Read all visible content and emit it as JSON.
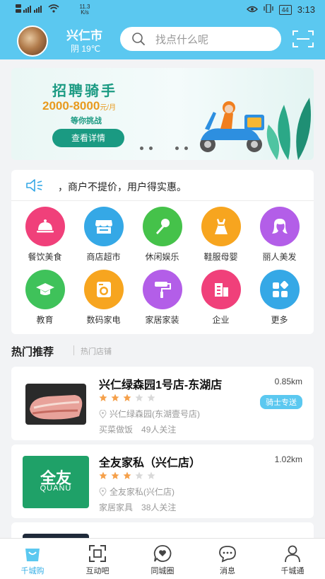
{
  "status_bar": {
    "net_speed": "11.3",
    "net_unit": "K/s",
    "battery": "44",
    "time": "3:13"
  },
  "header": {
    "city": "兴仁市",
    "weather": "阴 19℃",
    "search_placeholder": "找点什么呢"
  },
  "banner": {
    "title": "招聘骑手",
    "salary": "2000-8000",
    "salary_unit": "元/月",
    "subtitle": "等你挑战",
    "button": "查看详情"
  },
  "notice": {
    "text": "，商户不提价，用户得实惠。"
  },
  "categories": [
    {
      "label": "餐饮美食",
      "icon": "food-cloche-icon",
      "color": "#f0407a"
    },
    {
      "label": "商店超市",
      "icon": "store-icon",
      "color": "#35a8e6"
    },
    {
      "label": "休闲娱乐",
      "icon": "microphone-icon",
      "color": "#45c24a"
    },
    {
      "label": "鞋服母婴",
      "icon": "dress-icon",
      "color": "#f7a51f"
    },
    {
      "label": "丽人美发",
      "icon": "beauty-hair-icon",
      "color": "#b35ee8"
    },
    {
      "label": "教育",
      "icon": "graduation-cap-icon",
      "color": "#3fc25a"
    },
    {
      "label": "数码家电",
      "icon": "washing-machine-icon",
      "color": "#f7a51f"
    },
    {
      "label": "家居家装",
      "icon": "paint-roller-icon",
      "color": "#b35ee8"
    },
    {
      "label": "企业",
      "icon": "building-icon",
      "color": "#f0407a"
    },
    {
      "label": "更多",
      "icon": "more-grid-icon",
      "color": "#35a8e6"
    }
  ],
  "section": {
    "title": "热门推荐",
    "subtitle": "热门店铺"
  },
  "shops": [
    {
      "name": "兴仁绿森园1号店-东湖店",
      "distance": "0.85km",
      "rating": 3,
      "address": "兴仁绿森园(东湖壹号店)",
      "category": "买菜做饭",
      "followers": "49人关注",
      "badge": "骑士专送"
    },
    {
      "name": "全友家私（兴仁店）",
      "distance": "1.02km",
      "rating": 3,
      "address": "全友家私(兴仁店)",
      "category": "家居家具",
      "followers": "38人关注",
      "logo_text": "全友",
      "logo_sub": "QUANU"
    }
  ],
  "tabs": [
    {
      "label": "千城购",
      "icon": "shopping-bag-icon",
      "active": true
    },
    {
      "label": "互动吧",
      "icon": "scan-frame-icon",
      "active": false
    },
    {
      "label": "同城圈",
      "icon": "heart-chat-icon",
      "active": false
    },
    {
      "label": "消息",
      "icon": "message-bubble-icon",
      "active": false
    },
    {
      "label": "千城通",
      "icon": "user-icon",
      "active": false
    }
  ],
  "colors": {
    "primary": "#5bc8f0",
    "banner_green": "#1a9a82",
    "salary_orange": "#e89a1e",
    "star_orange": "#f5a04a"
  }
}
